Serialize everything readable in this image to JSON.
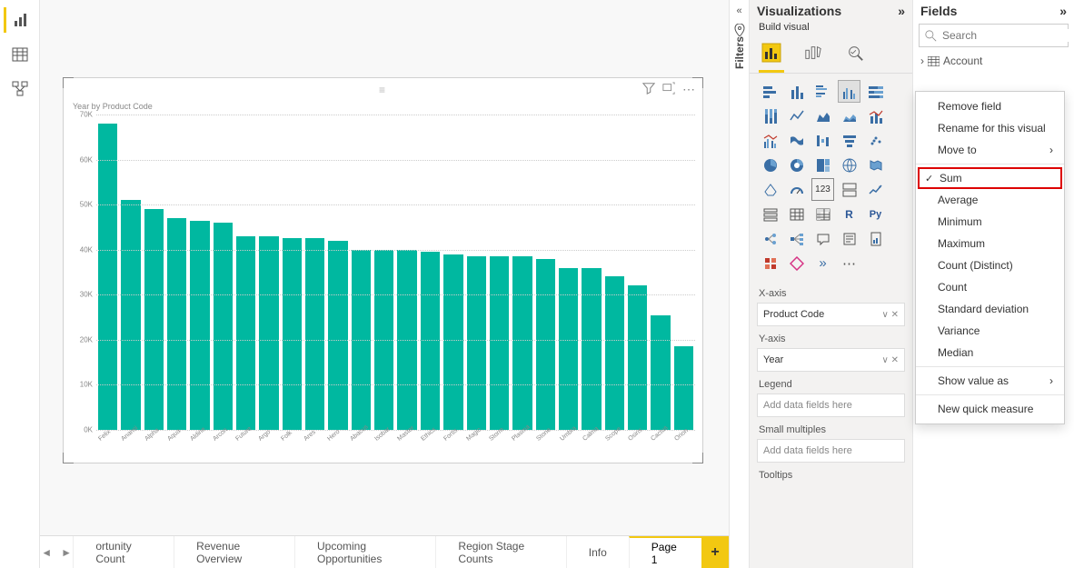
{
  "leftTabs": [
    "report-view",
    "data-view",
    "model-view"
  ],
  "filtersPane": {
    "label": "Filters"
  },
  "chart_data": {
    "type": "bar",
    "title": "Year by Product Code",
    "xlabel": "",
    "ylabel": "",
    "ylim": [
      0,
      70000
    ],
    "yticks": [
      "0K",
      "10K",
      "20K",
      "30K",
      "40K",
      "50K",
      "60K",
      "70K"
    ],
    "categories": [
      "Felix",
      "Anansi",
      "Alpha",
      "Aqua",
      "Aldine",
      "Arcon",
      "Future",
      "Argo",
      "Folk",
      "Ares",
      "Hero",
      "Abacus",
      "Isobar",
      "Master",
      "Ethics",
      "Fortis",
      "Magic",
      "Storm",
      "Plasma",
      "Stone",
      "Umbra",
      "Calma",
      "Scope",
      "Osiris",
      "Cactus",
      "Orion"
    ],
    "values": [
      68000,
      51000,
      49000,
      47000,
      46500,
      46000,
      43000,
      43000,
      42500,
      42500,
      42000,
      40000,
      40000,
      40000,
      39500,
      39000,
      38500,
      38500,
      38500,
      38000,
      36000,
      36000,
      34000,
      32000,
      25500,
      18500
    ]
  },
  "vizPane": {
    "title": "Visualizations",
    "buildLabel": "Build visual",
    "moreLabel": "⋯",
    "wells": {
      "xaxis": {
        "label": "X-axis",
        "value": "Product Code"
      },
      "yaxis": {
        "label": "Y-axis",
        "value": "Year"
      },
      "legend": {
        "label": "Legend",
        "placeholder": "Add data fields here"
      },
      "smallMultiples": {
        "label": "Small multiples",
        "placeholder": "Add data fields here"
      },
      "tooltips": {
        "label": "Tooltips"
      }
    }
  },
  "fieldsPane": {
    "title": "Fields",
    "searchPlaceholder": "Search",
    "item1": "Account"
  },
  "contextMenu": {
    "removeField": "Remove field",
    "rename": "Rename for this visual",
    "moveTo": "Move to",
    "sum": "Sum",
    "average": "Average",
    "minimum": "Minimum",
    "maximum": "Maximum",
    "countDistinct": "Count (Distinct)",
    "count": "Count",
    "stddev": "Standard deviation",
    "variance": "Variance",
    "median": "Median",
    "showValueAs": "Show value as",
    "newQuick": "New quick measure"
  },
  "tabs": {
    "t1": "ortunity Count",
    "t2": "Revenue Overview",
    "t3": "Upcoming Opportunities",
    "t4": "Region Stage Counts",
    "t5": "Info",
    "t6": "Page 1"
  }
}
